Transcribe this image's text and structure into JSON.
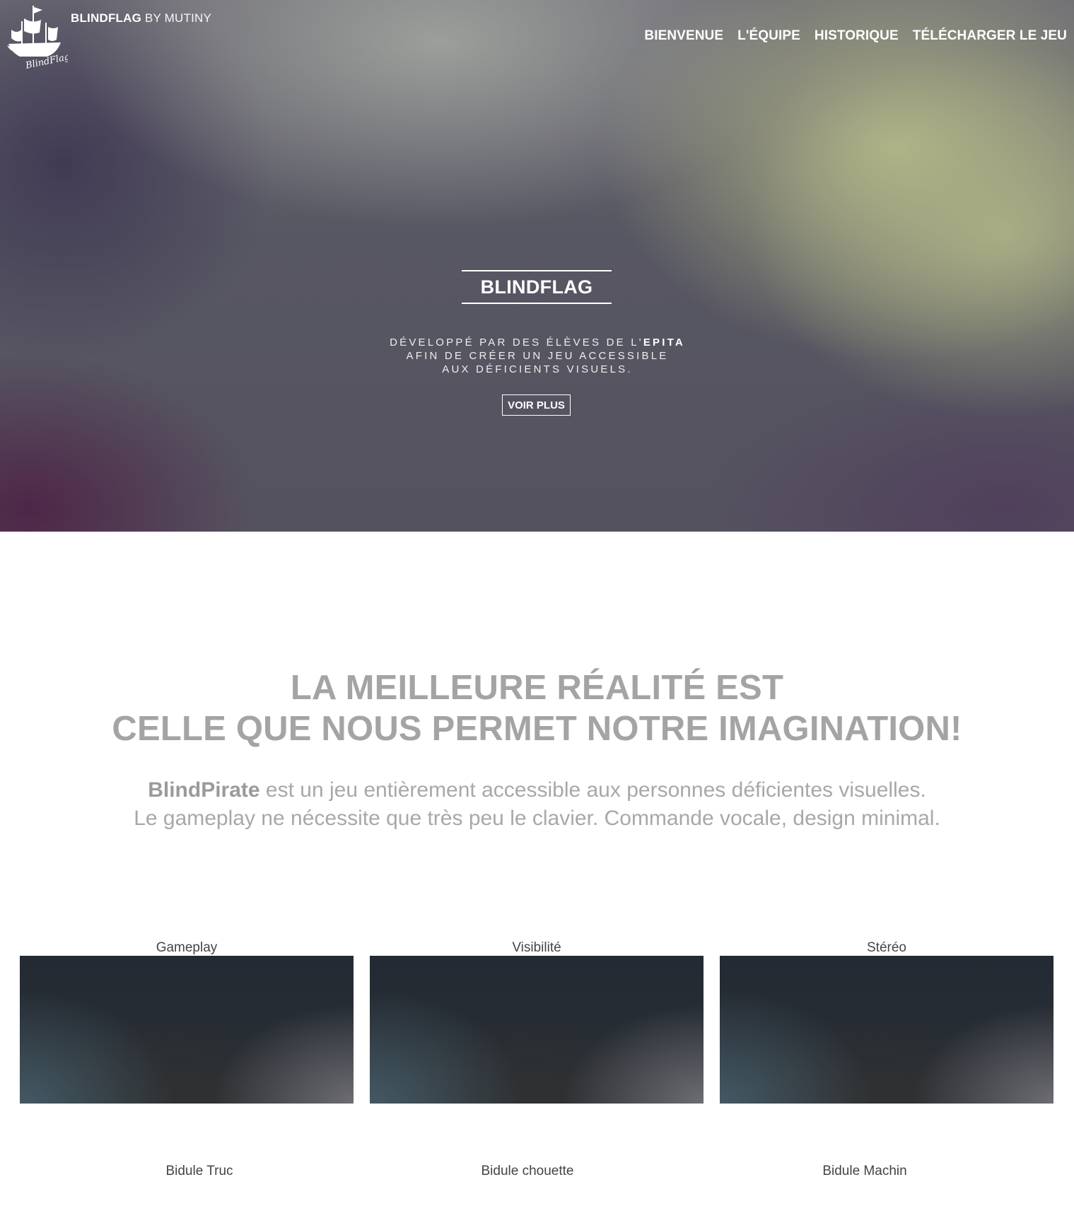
{
  "header": {
    "logo_text": "BlindFlag",
    "brand_name": "BLINDFLAG",
    "brand_suffix": "BY MUTINY",
    "nav": [
      "BIENVENUE",
      "L'ÉQUIPE",
      "HISTORIQUE",
      "TÉLÉCHARGER LE JEU"
    ]
  },
  "hero": {
    "title": "BLINDFLAG",
    "subtitle_line1_prefix": "DÉVELOPPÉ PAR DES ÉLÈVES DE L'",
    "subtitle_line1_em": "EPITA",
    "subtitle_line2": "AFIN DE CRÉER UN JEU ACCESSIBLE",
    "subtitle_line3": "AUX DÉFICIENTS VISUELS.",
    "button": "VOIR PLUS"
  },
  "intro": {
    "headline_line1": "LA MEILLEURE RÉALITÉ EST",
    "headline_line2": "CELLE QUE NOUS PERMET NOTRE IMAGINATION!",
    "text_bold": "BlindPirate",
    "text_line1": " est un jeu entièrement accessible aux personnes déficientes visuelles.",
    "text_line2": "Le gameplay ne nécessite que très peu le clavier. Commande vocale, design minimal."
  },
  "features": [
    {
      "label": "Gameplay"
    },
    {
      "label": "Visibilité"
    },
    {
      "label": "Stéréo"
    }
  ],
  "sublabels": [
    "Bidule Truc",
    "Bidule chouette",
    "Bidule Machin"
  ]
}
